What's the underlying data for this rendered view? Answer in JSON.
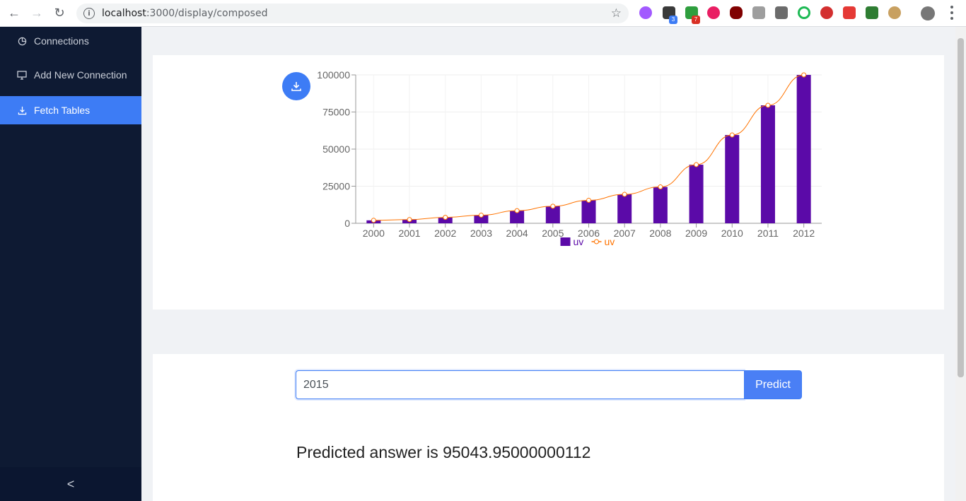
{
  "browser": {
    "url_host": "localhost",
    "url_path": ":3000/display/composed",
    "ext_badges": [
      "3",
      "7"
    ]
  },
  "sidebar": {
    "items": [
      {
        "label": "Connections",
        "icon": "pie-chart-icon"
      },
      {
        "label": "Add New Connection",
        "icon": "desktop-icon"
      },
      {
        "label": "Fetch Tables",
        "icon": "download-icon",
        "active": true
      }
    ],
    "collapse_glyph": "<"
  },
  "chart_data": {
    "type": "bar",
    "categories": [
      "2000",
      "2001",
      "2002",
      "2003",
      "2004",
      "2005",
      "2006",
      "2007",
      "2008",
      "2009",
      "2010",
      "2011",
      "2012"
    ],
    "series": [
      {
        "name": "uv",
        "type": "bar",
        "color": "#5b0aa8",
        "values": [
          2000,
          2500,
          4000,
          5500,
          8500,
          11500,
          15500,
          19500,
          24500,
          39500,
          59500,
          79500,
          100000
        ]
      },
      {
        "name": "uv",
        "type": "line",
        "color": "#ff7300",
        "values": [
          2000,
          2500,
          4000,
          5500,
          8500,
          11500,
          15500,
          19500,
          24500,
          39500,
          59500,
          79500,
          100000
        ]
      }
    ],
    "yticks": [
      "0",
      "25000",
      "50000",
      "75000",
      "100000"
    ],
    "ylim": [
      0,
      100000
    ],
    "grid": true,
    "legend": "bottom"
  },
  "predict": {
    "input_value": "2015",
    "button_label": "Predict",
    "result_text": "Predicted answer is 95043.95000000112"
  }
}
